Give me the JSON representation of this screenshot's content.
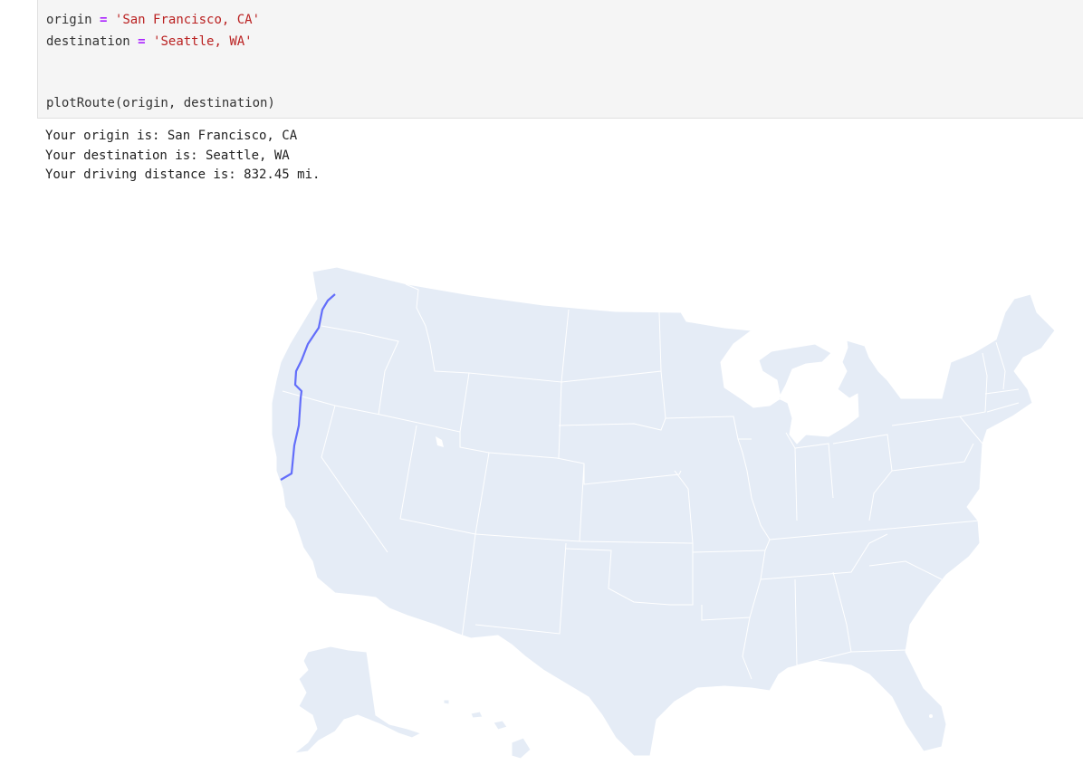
{
  "cell": {
    "line1": {
      "var": "origin",
      "op": "=",
      "val": "'San Francisco, CA'"
    },
    "line2": {
      "var": "destination",
      "op": "=",
      "val": "'Seattle, WA'"
    },
    "line3": "plotRoute(origin, destination)"
  },
  "output": {
    "origin_line": "Your origin is: San Francisco, CA",
    "destination_line": "Your destination is: Seattle, WA",
    "distance_line": "Your driving distance is: 832.45 mi."
  },
  "map": {
    "land_color": "#e5ecf6",
    "border_color": "#ffffff",
    "route_color": "#636efa"
  }
}
